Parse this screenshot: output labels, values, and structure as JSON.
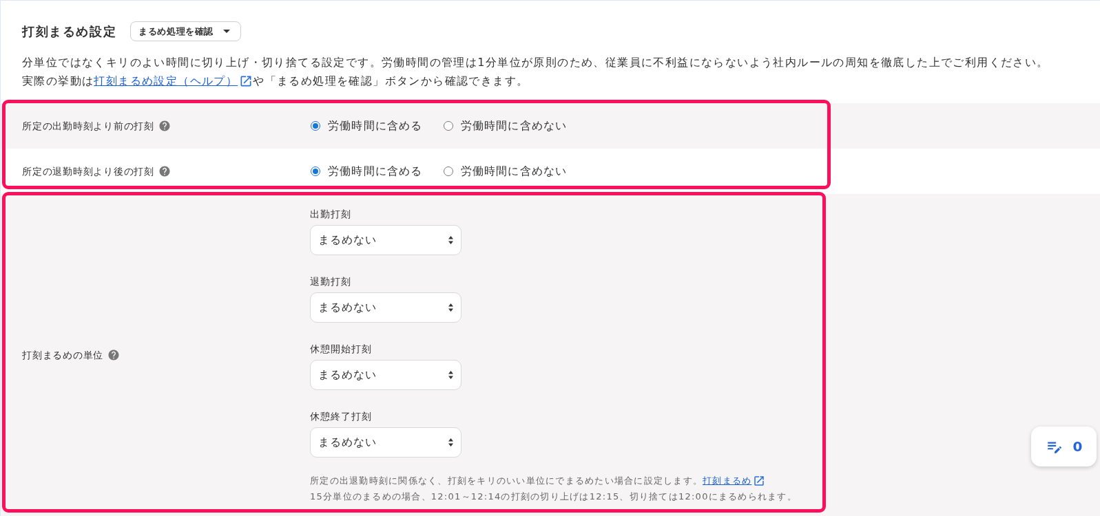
{
  "header": {
    "title": "打刻まるめ設定",
    "check_button": {
      "label": "まるめ処理を確認"
    }
  },
  "description": {
    "line_1": "分単位ではなくキリのよい時間に切り上げ・切り捨てる設定です。労働時間の管理は1分単位が原則のため、従業員に不利益にならないよう社内ルールの周知を徹底した上でご利用ください。",
    "line_2": {
      "before": "実際の挙動は",
      "link": "打刻まるめ設定（ヘルプ）",
      "after": "や「まるめ処理を確認」ボタンから確認できます。"
    }
  },
  "attendance_rules": [
    {
      "label": "所定の出勤時刻より前の打刻",
      "options": [
        {
          "label": "労働時間に含める",
          "selected": true
        },
        {
          "label": "労働時間に含めない",
          "selected": false
        }
      ]
    },
    {
      "label": "所定の退勤時刻より後の打刻",
      "options": [
        {
          "label": "労働時間に含める",
          "selected": true
        },
        {
          "label": "労働時間に含めない",
          "selected": false
        }
      ]
    }
  ],
  "rounding_unit": {
    "label": "打刻まるめの単位",
    "fields": [
      {
        "label": "出勤打刻",
        "value": "まるめない"
      },
      {
        "label": "退勤打刻",
        "value": "まるめない"
      },
      {
        "label": "休憩開始打刻",
        "value": "まるめない"
      },
      {
        "label": "休憩終了打刻",
        "value": "まるめない"
      }
    ],
    "help": {
      "text": "所定の出退勤時刻に関係なく、打刻をキリのいい単位にでまるめたい場合に設定します。",
      "link": "打刻まるめ",
      "note": "15分単位のまるめの場合、12:01～12:14の打刻の切り上げは12:15、切り捨ては12:00にまるめられます。"
    }
  },
  "notes_button": {
    "count": "0"
  }
}
